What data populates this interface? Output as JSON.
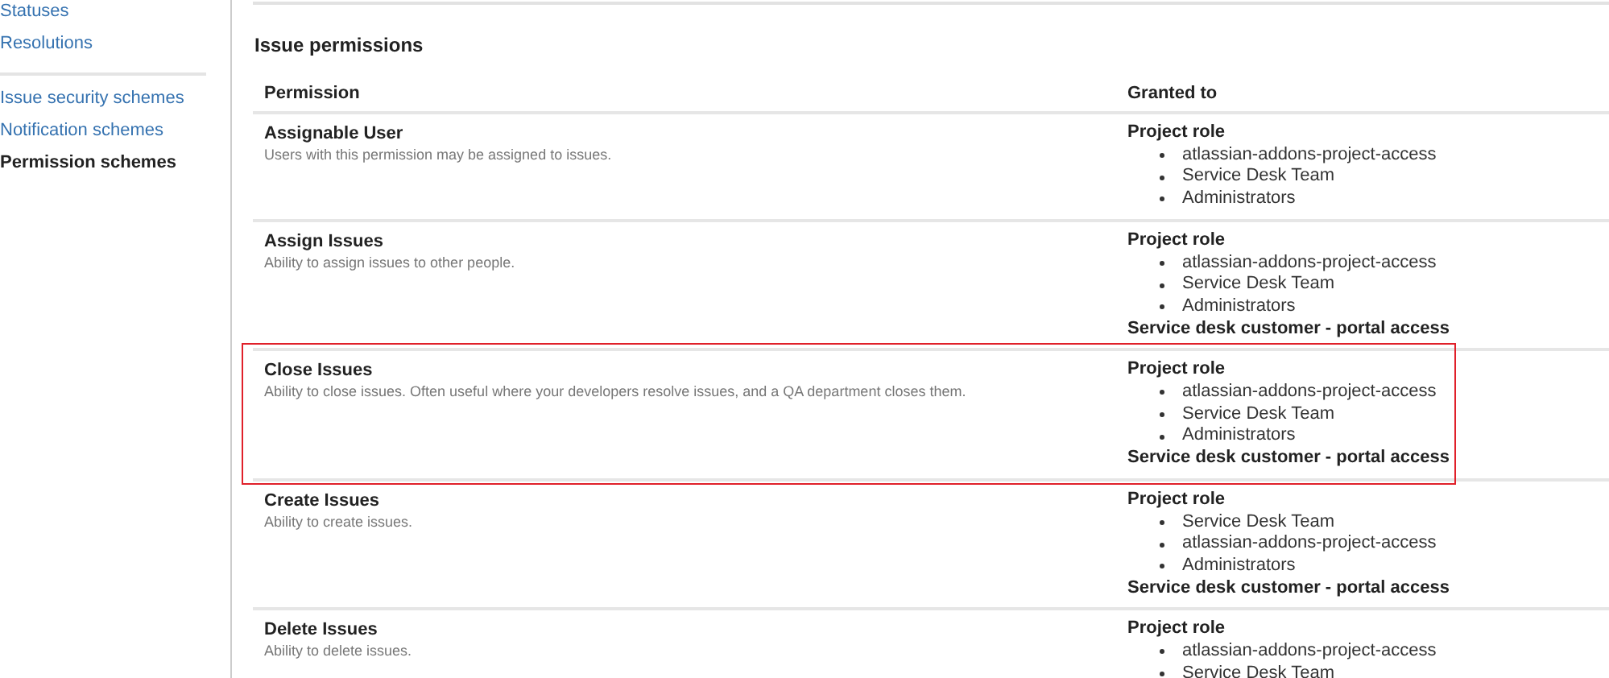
{
  "sidebar": {
    "groups": [
      [
        {
          "label": "Statuses",
          "selected": false
        },
        {
          "label": "Resolutions",
          "selected": false
        }
      ],
      [
        {
          "label": "Issue security schemes",
          "selected": false
        },
        {
          "label": "Notification schemes",
          "selected": false
        },
        {
          "label": "Permission schemes",
          "selected": true
        }
      ]
    ]
  },
  "section_title": "Issue permissions",
  "table": {
    "columns": [
      "Permission",
      "Granted to"
    ],
    "rows": [
      {
        "name": "Assignable User",
        "description": "Users with this permission may be assigned to issues.",
        "highlighted": false,
        "granted": [
          {
            "heading": "Project role",
            "members": [
              "atlassian-addons-project-access",
              "Service Desk Team",
              "Administrators"
            ]
          }
        ]
      },
      {
        "name": "Assign Issues",
        "description": "Ability to assign issues to other people.",
        "highlighted": false,
        "granted": [
          {
            "heading": "Project role",
            "members": [
              "atlassian-addons-project-access",
              "Service Desk Team",
              "Administrators"
            ]
          },
          {
            "heading": "Service desk customer - portal access"
          }
        ]
      },
      {
        "name": "Close Issues",
        "description": "Ability to close issues. Often useful where your developers resolve issues, and a QA department closes them.",
        "highlighted": true,
        "granted": [
          {
            "heading": "Project role",
            "members": [
              "atlassian-addons-project-access",
              "Service Desk Team",
              "Administrators"
            ]
          },
          {
            "heading": "Service desk customer - portal access"
          }
        ]
      },
      {
        "name": "Create Issues",
        "description": "Ability to create issues.",
        "highlighted": false,
        "granted": [
          {
            "heading": "Project role",
            "members": [
              "Service Desk Team",
              "atlassian-addons-project-access",
              "Administrators"
            ]
          },
          {
            "heading": "Service desk customer - portal access"
          }
        ]
      },
      {
        "name": "Delete Issues",
        "description": "Ability to delete issues.",
        "highlighted": false,
        "granted": [
          {
            "heading": "Project role",
            "members": [
              "atlassian-addons-project-access",
              "Service Desk Team"
            ]
          }
        ]
      }
    ]
  }
}
